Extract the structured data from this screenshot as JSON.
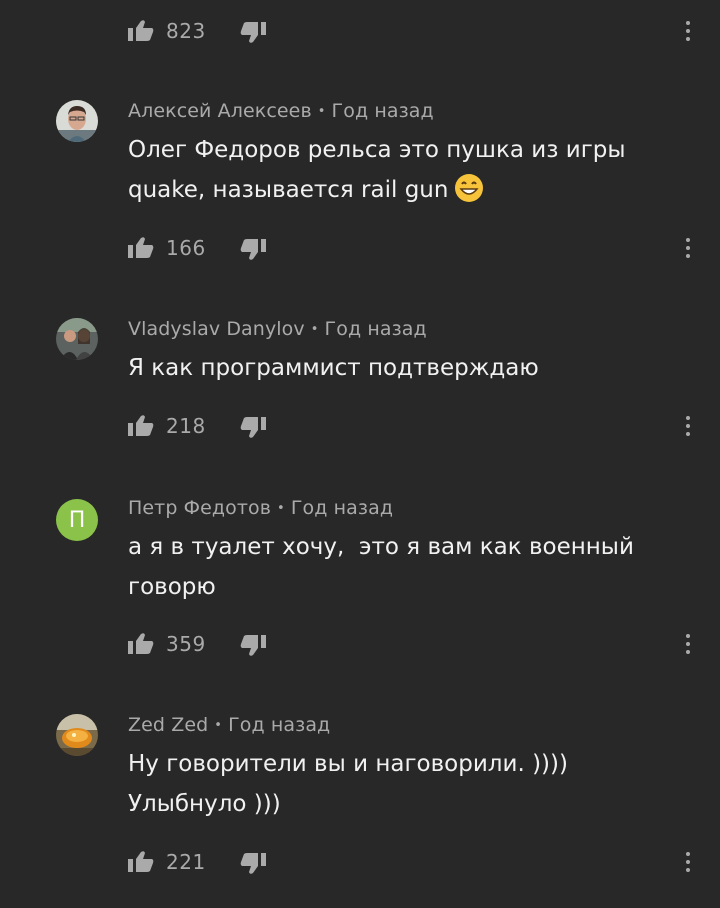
{
  "comments": [
    {
      "author": "",
      "time": "",
      "text": "",
      "likes": "823"
    },
    {
      "author": "Алексей Алексеев",
      "time": "Год назад",
      "text_line1": "Олег Федоров рельса это пушка из игры",
      "text_line2": "quake, называется rail gun",
      "likes": "166"
    },
    {
      "author": "Vladyslav Danylov",
      "time": "Год назад",
      "text_line1": "Я как программист подтверждаю",
      "likes": "218"
    },
    {
      "author": "Петр Федотов",
      "time": "Год назад",
      "avatar_letter": "П",
      "avatar_color": "#8bc34a",
      "text_line1": "а я в туалет хочу,  это я вам как военный",
      "text_line2": "говорю",
      "likes": "359"
    },
    {
      "author": "Zed Zed",
      "time": "Год назад",
      "text_line1": "Ну говорители вы и наговорили. ))))",
      "text_line2": "Улыбнуло )))",
      "likes": "221"
    }
  ],
  "icons": {
    "like": "thumbs-up-icon",
    "dislike": "thumbs-down-icon",
    "more": "vertical-dots-icon",
    "emoji": "grinning-face-emoji"
  },
  "meta_separator": "•",
  "colors": {
    "background": "#282828",
    "text": "#f1f1f1",
    "secondary": "#aaaaaa"
  }
}
